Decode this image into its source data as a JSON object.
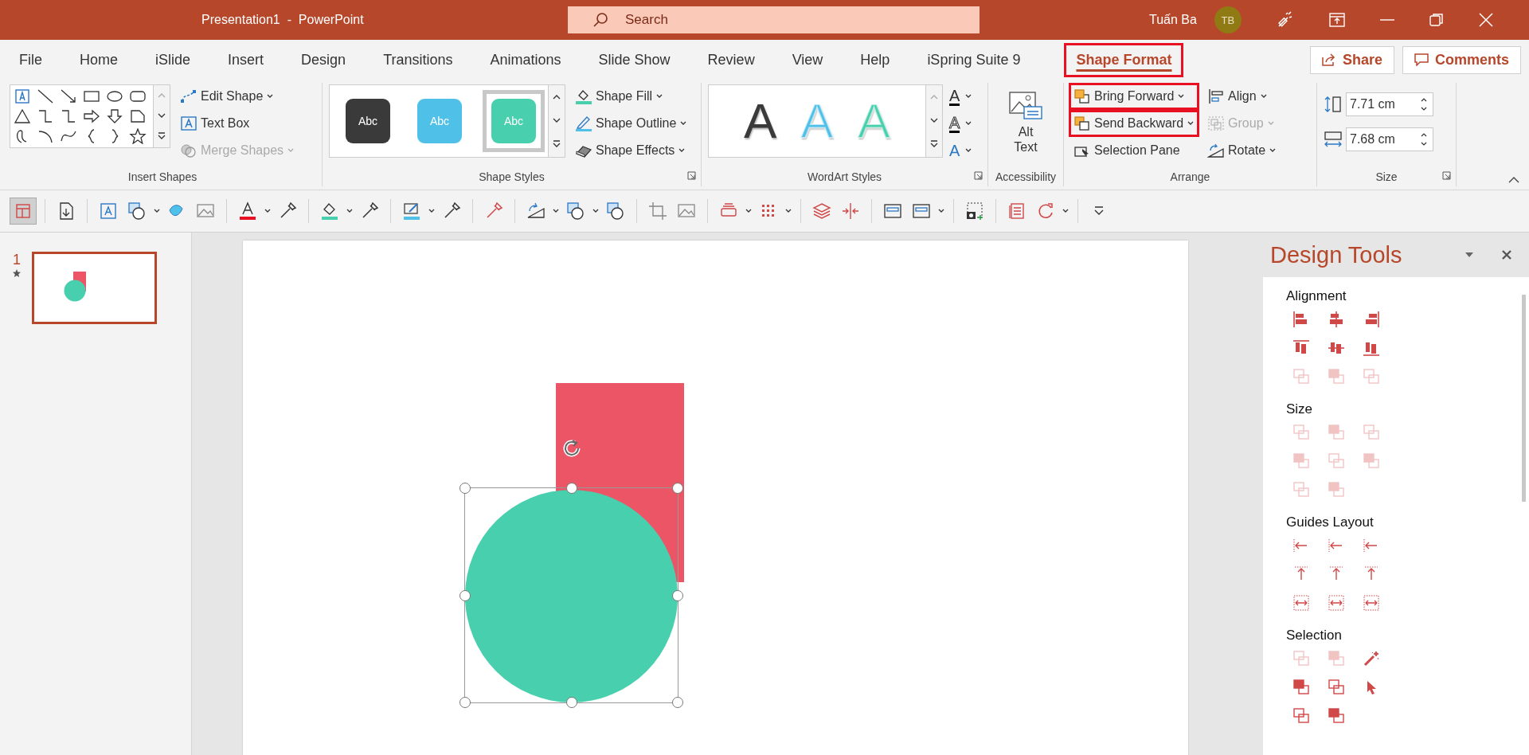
{
  "window": {
    "title": "Presentation1  -  PowerPoint",
    "search_placeholder": "Search",
    "user_name": "Tuấn Ba",
    "avatar_initials": "TB"
  },
  "tabs": [
    {
      "label": "File",
      "selected": false,
      "highlighted": false
    },
    {
      "label": "Home",
      "selected": false,
      "highlighted": false
    },
    {
      "label": "iSlide",
      "selected": false,
      "highlighted": false
    },
    {
      "label": "Insert",
      "selected": false,
      "highlighted": false
    },
    {
      "label": "Design",
      "selected": false,
      "highlighted": false
    },
    {
      "label": "Transitions",
      "selected": false,
      "highlighted": false
    },
    {
      "label": "Animations",
      "selected": false,
      "highlighted": false
    },
    {
      "label": "Slide Show",
      "selected": false,
      "highlighted": false
    },
    {
      "label": "Review",
      "selected": false,
      "highlighted": false
    },
    {
      "label": "View",
      "selected": false,
      "highlighted": false
    },
    {
      "label": "Help",
      "selected": false,
      "highlighted": false
    },
    {
      "label": "iSpring Suite 9",
      "selected": false,
      "highlighted": false
    },
    {
      "label": "Shape Format",
      "selected": true,
      "highlighted": true
    }
  ],
  "share_button": "Share",
  "comments_button": "Comments",
  "ribbon": {
    "insert_shapes": {
      "label": "Insert Shapes",
      "buttons": [
        {
          "label": "Edit Shape",
          "disabled": false,
          "dropdown": true
        },
        {
          "label": "Text Box",
          "disabled": false,
          "dropdown": false
        },
        {
          "label": "Merge Shapes",
          "disabled": true,
          "dropdown": true
        }
      ]
    },
    "shape_styles": {
      "label": "Shape Styles",
      "swatches": [
        {
          "text": "Abc",
          "color": "#3a3a3a",
          "selected": false
        },
        {
          "text": "Abc",
          "color": "#4fc1e9",
          "selected": false
        },
        {
          "text": "Abc",
          "color": "#48cfad",
          "selected": true
        }
      ],
      "buttons": [
        {
          "label": "Shape Fill"
        },
        {
          "label": "Shape Outline"
        },
        {
          "label": "Shape Effects"
        }
      ]
    },
    "wordart_styles": {
      "label": "WordArt Styles",
      "samples": [
        {
          "text": "A",
          "color": "#3a3a3a"
        },
        {
          "text": "A",
          "color": "#4fc1e9"
        },
        {
          "text": "A",
          "color": "#48cfad"
        }
      ],
      "tools": [
        {
          "text": "A"
        },
        {
          "text": "A"
        },
        {
          "text": "A"
        }
      ]
    },
    "accessibility": {
      "label": "Accessibility",
      "button": "Alt Text"
    },
    "arrange": {
      "label": "Arrange",
      "buttons": [
        {
          "label": "Bring Forward",
          "disabled": false,
          "highlighted": true
        },
        {
          "label": "Send Backward",
          "disabled": false,
          "highlighted": true
        },
        {
          "label": "Selection Pane",
          "disabled": false,
          "highlighted": false
        }
      ],
      "side_buttons": [
        {
          "label": "Align",
          "disabled": false
        },
        {
          "label": "Group",
          "disabled": true
        },
        {
          "label": "Rotate",
          "disabled": false
        }
      ]
    },
    "size": {
      "label": "Size",
      "height": "7.71 cm",
      "width": "7.68 cm"
    }
  },
  "slides": [
    {
      "number": "1",
      "selected": true
    }
  ],
  "shapes": [
    {
      "kind": "rectangle",
      "color": "#ec5565",
      "selected": false
    },
    {
      "kind": "circle",
      "color": "#48cfad",
      "selected": true
    }
  ],
  "design_tools": {
    "title": "Design Tools",
    "sections": [
      {
        "title": "Alignment",
        "icons": [
          {
            "disabled": false
          },
          {
            "disabled": false
          },
          {
            "disabled": false
          },
          {
            "disabled": false
          },
          {
            "disabled": false
          },
          {
            "disabled": false
          },
          {
            "disabled": true
          },
          {
            "disabled": true
          },
          {
            "disabled": true
          }
        ]
      },
      {
        "title": "Size",
        "icons": [
          {
            "disabled": true
          },
          {
            "disabled": true
          },
          {
            "disabled": true
          },
          {
            "disabled": true
          },
          {
            "disabled": true
          },
          {
            "disabled": true
          },
          {
            "disabled": true
          },
          {
            "disabled": true
          }
        ]
      },
      {
        "title": "Guides Layout",
        "icons": [
          {
            "disabled": false
          },
          {
            "disabled": false
          },
          {
            "disabled": false
          },
          {
            "disabled": false
          },
          {
            "disabled": false
          },
          {
            "disabled": false
          },
          {
            "disabled": false
          },
          {
            "disabled": false
          },
          {
            "disabled": false
          }
        ]
      },
      {
        "title": "Selection",
        "icons": [
          {
            "disabled": true
          },
          {
            "disabled": true
          },
          {
            "disabled": false
          },
          {
            "disabled": false
          },
          {
            "disabled": false
          },
          {
            "disabled": false
          },
          {
            "disabled": false
          },
          {
            "disabled": false
          }
        ]
      }
    ]
  }
}
